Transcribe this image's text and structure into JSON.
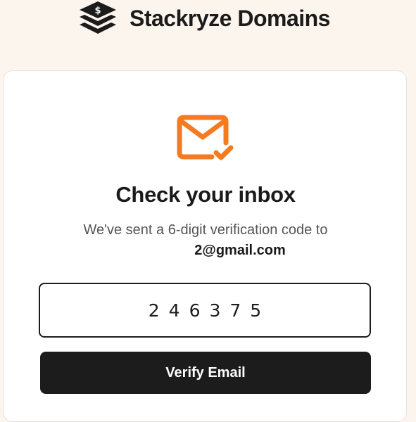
{
  "brand": {
    "name": "Stackryze Domains",
    "logo_icon": "stacked-layers-dollar-icon",
    "logo_color": "#1c1c1c"
  },
  "verification": {
    "icon": "mail-check-icon",
    "icon_color": "#f47b20",
    "title": "Check your inbox",
    "subtitle": "We've sent a 6-digit verification code to",
    "email_visible": "2@gmail.com",
    "code_value": "246375",
    "verify_label": "Verify Email"
  },
  "colors": {
    "page_background": "#fcf5ee",
    "card_background": "#ffffff",
    "button_background": "#1c1c1c",
    "button_text": "#ffffff",
    "accent": "#f47b20"
  }
}
